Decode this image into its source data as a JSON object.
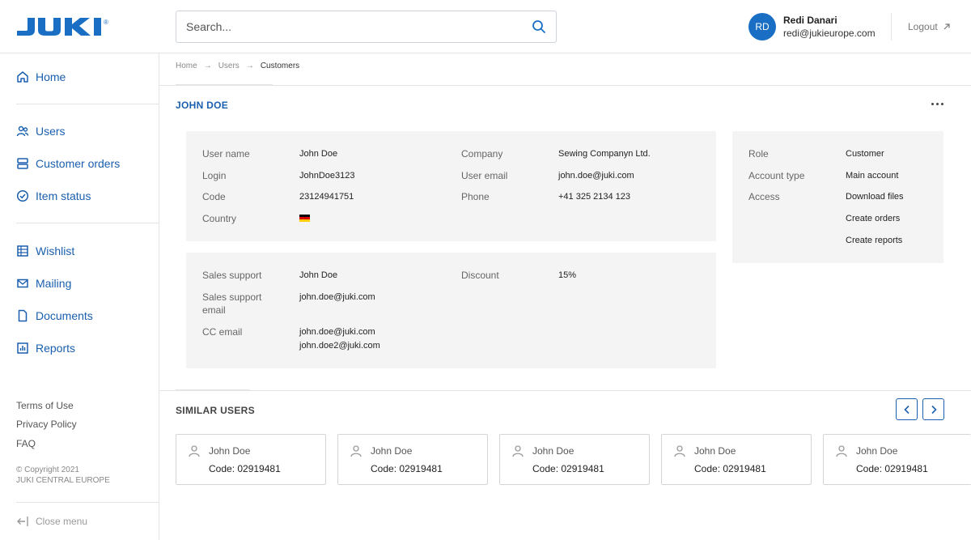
{
  "brand": {
    "logo_text": "JUKI",
    "accent": "#1a5fae"
  },
  "header": {
    "search_placeholder": "Search...",
    "user": {
      "initials": "RD",
      "name": "Redi Danari",
      "email": "redi@jukieurope.com"
    },
    "logout_label": "Logout"
  },
  "sidebar": {
    "items": [
      {
        "label": "Home",
        "icon": "home-icon"
      },
      {
        "label": "Users",
        "icon": "users-icon"
      },
      {
        "label": "Customer orders",
        "icon": "orders-icon"
      },
      {
        "label": "Item status",
        "icon": "check-circle-icon"
      },
      {
        "label": "Wishlist",
        "icon": "table-icon"
      },
      {
        "label": "Mailing",
        "icon": "mail-icon"
      },
      {
        "label": "Documents",
        "icon": "document-icon"
      },
      {
        "label": "Reports",
        "icon": "chart-icon"
      }
    ],
    "footer_links": [
      "Terms of Use",
      "Privacy Policy",
      "FAQ"
    ],
    "copyright_line1": "© Copyright 2021",
    "copyright_line2": "JUKI CENTRAL EUROPE",
    "close_menu": "Close menu"
  },
  "breadcrumb": [
    "Home",
    "Users",
    "Customers"
  ],
  "customer": {
    "title": "JOHN DOE",
    "general": [
      {
        "label": "User name",
        "value": "John Doe"
      },
      {
        "label": "Login",
        "value": "JohnDoe3123"
      },
      {
        "label": "Code",
        "value": "23124941751"
      },
      {
        "label": "Country",
        "value": ""
      }
    ],
    "company": [
      {
        "label": "Company",
        "value": "Sewing Companyn Ltd."
      },
      {
        "label": "User email",
        "value": "john.doe@juki.com"
      },
      {
        "label": "Phone",
        "value": "+41 325 2134 123"
      }
    ],
    "sales": [
      {
        "label": "Sales support",
        "value": "John Doe"
      },
      {
        "label": "Sales support email",
        "value": "john.doe@juki.com"
      },
      {
        "label": "CC email",
        "value": "john.doe@juki.com",
        "value2": "john.doe2@juki.com"
      }
    ],
    "discount": {
      "label": "Discount",
      "value": "15%"
    },
    "role": {
      "label": "Role",
      "value": "Customer"
    },
    "account_type": {
      "label": "Account type",
      "value": "Main account"
    },
    "access": {
      "label": "Access",
      "values": [
        "Download files",
        "Create orders",
        "Create reports"
      ]
    }
  },
  "similar_users": {
    "title": "SIMILAR USERS",
    "cards": [
      {
        "name": "John Doe",
        "code": "Code: 02919481"
      },
      {
        "name": "John Doe",
        "code": "Code: 02919481"
      },
      {
        "name": "John Doe",
        "code": "Code: 02919481"
      },
      {
        "name": "John Doe",
        "code": "Code: 02919481"
      },
      {
        "name": "John Doe",
        "code": "Code: 02919481"
      }
    ]
  }
}
